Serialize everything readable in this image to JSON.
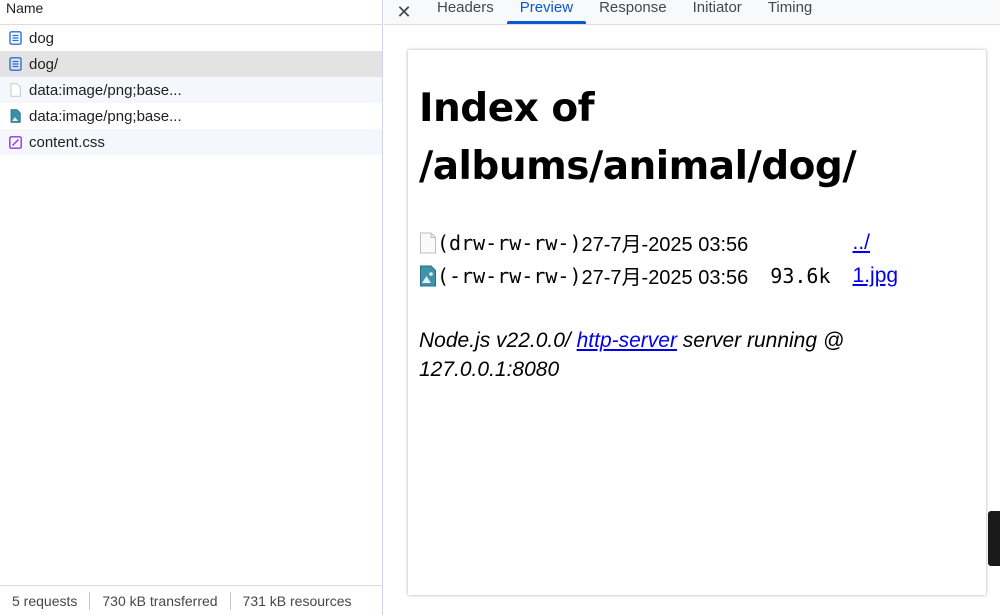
{
  "network": {
    "column_header": "Name",
    "rows": [
      {
        "label": "dog",
        "icon": "document-icon"
      },
      {
        "label": "dog/",
        "icon": "document-icon"
      },
      {
        "label": "data:image/png;base...",
        "icon": "blank-file-icon"
      },
      {
        "label": "data:image/png;base...",
        "icon": "image-file-icon"
      },
      {
        "label": "content.css",
        "icon": "stylesheet-icon"
      }
    ],
    "status": {
      "requests": "5 requests",
      "transferred": "730 kB transferred",
      "resources": "731 kB resources"
    }
  },
  "tabs": [
    "Headers",
    "Preview",
    "Response",
    "Initiator",
    "Timing"
  ],
  "preview": {
    "title_line1": "Index of",
    "title_line2": "/albums/animal/dog/",
    "entries": [
      {
        "perm": "(drw-rw-rw-)",
        "date": "27-7月-2025 03:56",
        "size": "",
        "link": "../"
      },
      {
        "perm": "(-rw-rw-rw-)",
        "date": "27-7月-2025 03:56",
        "size": "93.6k",
        "link": "1.jpg"
      }
    ],
    "footer_pre": "Node.js v22.0.0/ ",
    "footer_link": "http-server",
    "footer_post": " server running @",
    "footer_line2": "127.0.0.1:8080"
  },
  "colors": {
    "accent": "#0b57d0",
    "link": "#0000ee"
  }
}
